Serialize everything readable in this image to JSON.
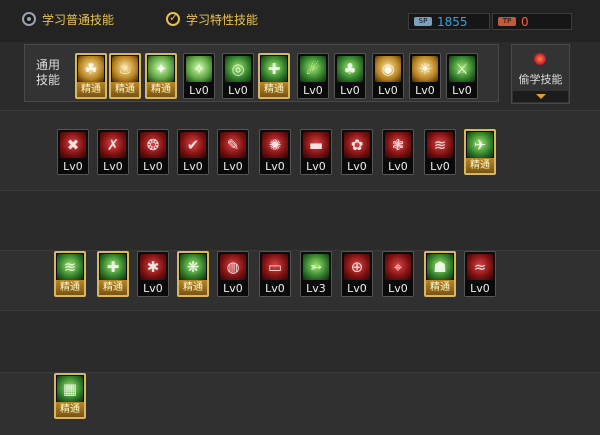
{
  "tabs": [
    {
      "label": "学习普通技能"
    },
    {
      "label": "学习特性技能"
    }
  ],
  "points": [
    {
      "tag": "SP",
      "value": "1855",
      "color": "#3aa0e0",
      "tag_color": "#7aa0c0"
    },
    {
      "tag": "TP",
      "value": "0",
      "color": "#ff5a3a",
      "tag_color": "#c05a3a"
    }
  ],
  "common": {
    "label": "通用技能"
  },
  "steal": {
    "label": "偷学技能"
  },
  "icons": [
    {
      "style": "gold",
      "glyph": "☘",
      "level": "精通",
      "master": true
    },
    {
      "style": "gold",
      "glyph": "♨",
      "level": "精通",
      "master": true
    },
    {
      "style": "ltgreen",
      "glyph": "✦",
      "level": "精通",
      "master": true
    },
    {
      "style": "ltgreen",
      "glyph": "✧",
      "level": "Lv0",
      "master": false
    },
    {
      "style": "green",
      "glyph": "◎",
      "level": "Lv0",
      "master": false
    },
    {
      "style": "green",
      "glyph": "✚",
      "level": "精通",
      "master": true
    },
    {
      "style": "green",
      "glyph": "☄",
      "level": "Lv0",
      "master": false
    },
    {
      "style": "green",
      "glyph": "♣",
      "level": "Lv0",
      "master": false
    },
    {
      "style": "gold",
      "glyph": "◉",
      "level": "Lv0",
      "master": false
    },
    {
      "style": "gold",
      "glyph": "☀",
      "level": "Lv0",
      "master": false
    },
    {
      "style": "green",
      "glyph": "⚔",
      "level": "Lv0",
      "master": false
    },
    {
      "style": "red",
      "glyph": "✖",
      "level": "Lv0",
      "master": false
    },
    {
      "style": "red",
      "glyph": "✗",
      "level": "Lv0",
      "master": false
    },
    {
      "style": "red",
      "glyph": "❂",
      "level": "Lv0",
      "master": false
    },
    {
      "style": "red",
      "glyph": "✔",
      "level": "Lv0",
      "master": false
    },
    {
      "style": "red",
      "glyph": "✎",
      "level": "Lv0",
      "master": false
    },
    {
      "style": "red",
      "glyph": "✺",
      "level": "Lv0",
      "master": false
    },
    {
      "style": "red",
      "glyph": "▬",
      "level": "Lv0",
      "master": false
    },
    {
      "style": "red",
      "glyph": "✿",
      "level": "Lv0",
      "master": false
    },
    {
      "style": "red",
      "glyph": "❃",
      "level": "Lv0",
      "master": false
    },
    {
      "style": "red",
      "glyph": "≋",
      "level": "Lv0",
      "master": false
    },
    {
      "style": "green",
      "glyph": "✈",
      "level": "精通",
      "master": true
    },
    {
      "style": "green",
      "glyph": "≋",
      "level": "精通",
      "master": true
    },
    {
      "style": "green",
      "glyph": "✚",
      "level": "精通",
      "master": true
    },
    {
      "style": "red",
      "glyph": "✱",
      "level": "Lv0",
      "master": false
    },
    {
      "style": "green",
      "glyph": "❋",
      "level": "精通",
      "master": true
    },
    {
      "style": "red",
      "glyph": "◍",
      "level": "Lv0",
      "master": false
    },
    {
      "style": "red",
      "glyph": "▭",
      "level": "Lv0",
      "master": false
    },
    {
      "style": "green",
      "glyph": "➳",
      "level": "Lv3",
      "master": false
    },
    {
      "style": "red",
      "glyph": "⊕",
      "level": "Lv0",
      "master": false
    },
    {
      "style": "red",
      "glyph": "⌖",
      "level": "Lv0",
      "master": false
    },
    {
      "style": "green",
      "glyph": "☗",
      "level": "精通",
      "master": true
    },
    {
      "style": "red",
      "glyph": "≈",
      "level": "Lv0",
      "master": false
    },
    {
      "style": "green",
      "glyph": "▦",
      "level": "精通",
      "master": true
    }
  ]
}
